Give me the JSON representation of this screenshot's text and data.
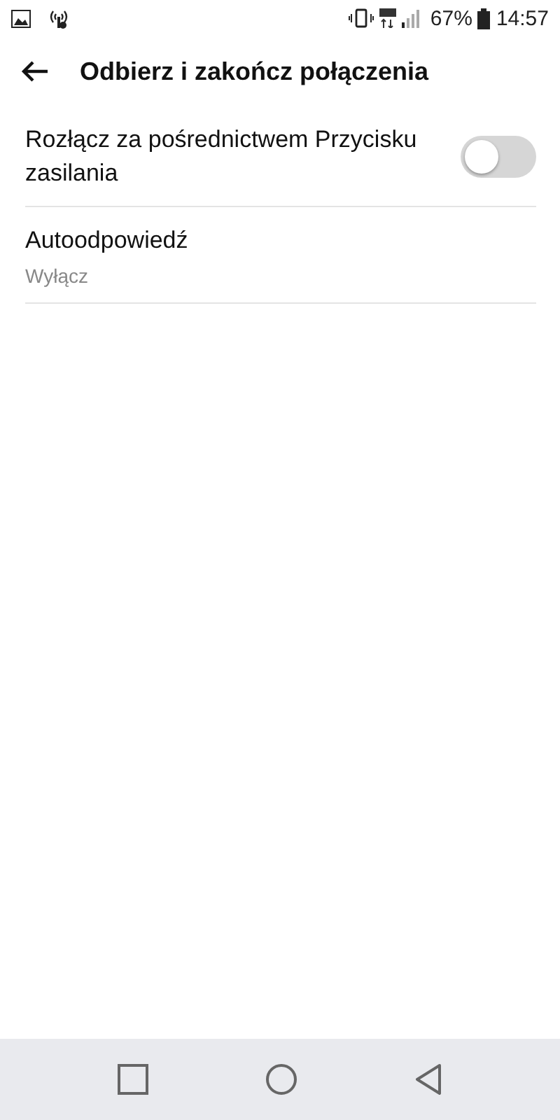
{
  "status_bar": {
    "battery": "67%",
    "time": "14:57"
  },
  "app_bar": {
    "title": "Odbierz i zakończ połączenia"
  },
  "settings": [
    {
      "kind": "toggle",
      "label": "Rozłącz za pośrednictwem Przycisku zasilania",
      "on": false
    },
    {
      "kind": "value",
      "label": "Autoodpowiedź",
      "value": "Wyłącz"
    }
  ]
}
